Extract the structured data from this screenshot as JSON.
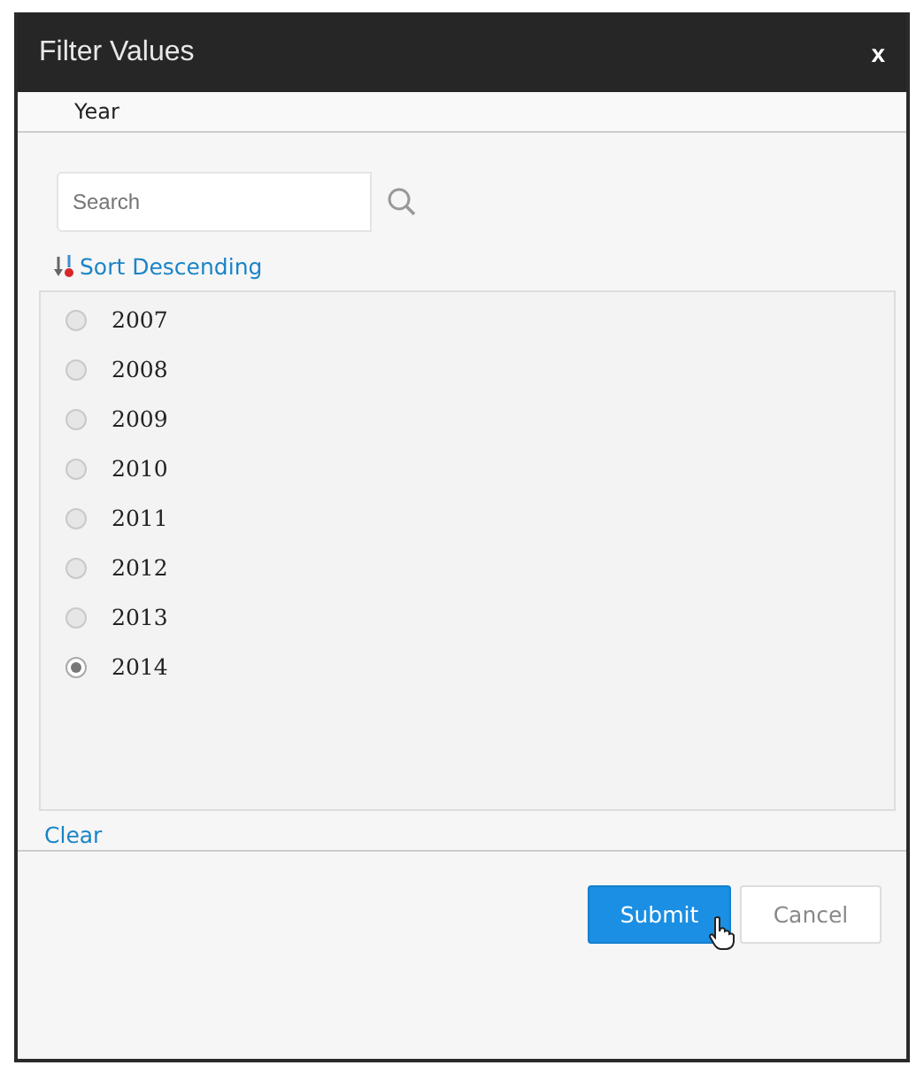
{
  "dialog": {
    "title": "Filter Values",
    "close": "x"
  },
  "column": {
    "label": "Year"
  },
  "search": {
    "placeholder": "Search"
  },
  "sort": {
    "label": "Sort Descending"
  },
  "options": [
    {
      "label": "2007",
      "selected": false
    },
    {
      "label": "2008",
      "selected": false
    },
    {
      "label": "2009",
      "selected": false
    },
    {
      "label": "2010",
      "selected": false
    },
    {
      "label": "2011",
      "selected": false
    },
    {
      "label": "2012",
      "selected": false
    },
    {
      "label": "2013",
      "selected": false
    },
    {
      "label": "2014",
      "selected": true
    }
  ],
  "clear": "Clear",
  "buttons": [
    {
      "label": "Submit",
      "kind": "primary"
    },
    {
      "label": "Cancel",
      "kind": "secondary"
    }
  ]
}
